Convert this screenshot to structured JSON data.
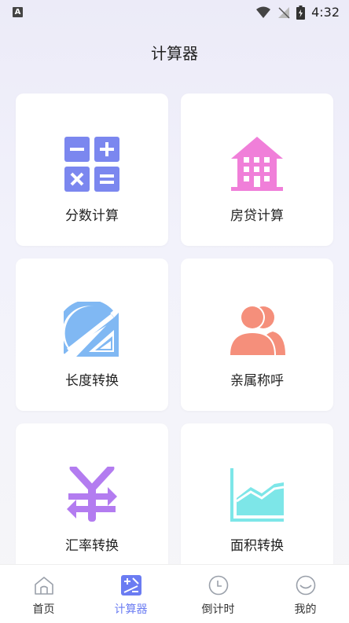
{
  "status": {
    "time": "4:32",
    "indicator": "A"
  },
  "page": {
    "title": "计算器"
  },
  "cards": [
    {
      "label": "分数计算",
      "icon": "calculator-icon",
      "color": "#7b87ef"
    },
    {
      "label": "房贷计算",
      "icon": "house-icon",
      "color": "#f07fd9"
    },
    {
      "label": "长度转换",
      "icon": "ruler-icon",
      "color": "#80b8f3"
    },
    {
      "label": "亲属称呼",
      "icon": "people-icon",
      "color": "#f58f7b"
    },
    {
      "label": "汇率转换",
      "icon": "yuan-exchange-icon",
      "color": "#b37cf0"
    },
    {
      "label": "面积转换",
      "icon": "area-chart-icon",
      "color": "#7de6e8"
    }
  ],
  "nav": [
    {
      "label": "首页",
      "icon": "home-icon",
      "active": false
    },
    {
      "label": "计算器",
      "icon": "calculator-icon",
      "active": true
    },
    {
      "label": "倒计时",
      "icon": "clock-icon",
      "active": false
    },
    {
      "label": "我的",
      "icon": "smile-icon",
      "active": false
    }
  ],
  "colors": {
    "accent": "#6b7cf2",
    "nav_inactive": "#9aa0aa"
  }
}
